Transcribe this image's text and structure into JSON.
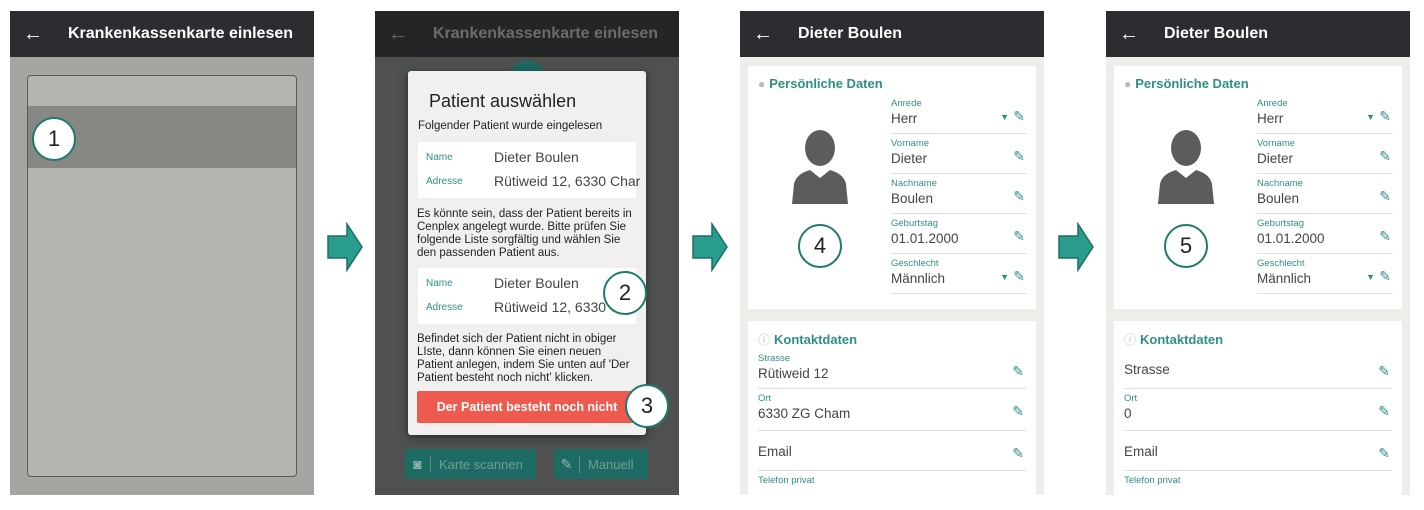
{
  "screen1": {
    "title": "Krankenkassenkarte einlesen",
    "callout": "1"
  },
  "screen2": {
    "title": "Krankenkassenkarte einlesen",
    "dialog_title": "Patient auswählen",
    "intro": "Folgender Patient wurde eingelesen",
    "card1": {
      "name_label": "Name",
      "name": "Dieter Boulen",
      "address_label": "Adresse",
      "address": "Rütiweid 12, 6330 Char"
    },
    "para1": "Es könnte sein, dass der Patient bereits in Cenplex angelegt wurde. Bitte prüfen Sie folgende Liste sorgfältig und wählen Sie den passenden Patient aus.",
    "card2": {
      "name_label": "Name",
      "name": "Dieter Boulen",
      "address_label": "Adresse",
      "address": "Rütiweid 12, 6330 Ch"
    },
    "para2": "Befindet sich der Patient nicht in obiger LIste, dann können Sie einen neuen Patient anlegen, indem Sie unten auf 'Der Patient besteht noch nicht' klicken.",
    "new_patient_button": "Der Patient besteht noch nicht",
    "scan_button": "Karte scannen",
    "manual_button": "Manuell",
    "callout_a": "2",
    "callout_b": "3"
  },
  "screen3": {
    "title": "Dieter Boulen",
    "section_personal": "Persönliche Daten",
    "fields": [
      {
        "label": "Anrede",
        "value": "Herr"
      },
      {
        "label": "Vorname",
        "value": "Dieter"
      },
      {
        "label": "Nachname",
        "value": "Boulen"
      },
      {
        "label": "Geburtstag",
        "value": "01.01.2000"
      },
      {
        "label": "Geschlecht",
        "value": "Männlich"
      }
    ],
    "section_contact": "Kontaktdaten",
    "contact": [
      {
        "label": "Strasse",
        "value": "Rütiweid 12"
      },
      {
        "label": "Ort",
        "value": "6330 ZG  Cham"
      },
      {
        "label": "",
        "value": "Email"
      },
      {
        "label": "Telefon privat",
        "value": ""
      }
    ],
    "callout": "4"
  },
  "screen4": {
    "title": "Dieter Boulen",
    "section_personal": "Persönliche Daten",
    "fields": [
      {
        "label": "Anrede",
        "value": "Herr"
      },
      {
        "label": "Vorname",
        "value": "Dieter"
      },
      {
        "label": "Nachname",
        "value": "Boulen"
      },
      {
        "label": "Geburtstag",
        "value": "01.01.2000"
      },
      {
        "label": "Geschlecht",
        "value": "Männlich"
      }
    ],
    "section_contact": "Kontaktdaten",
    "contact": [
      {
        "label": "",
        "value": "Strasse"
      },
      {
        "label": "Ort",
        "value": "0"
      },
      {
        "label": "",
        "value": "Email"
      },
      {
        "label": "Telefon privat",
        "value": ""
      }
    ],
    "callout": "5"
  },
  "icons": {
    "back": "arrow-left-icon",
    "edit": "pencil-icon",
    "dropdown": "caret-down-icon",
    "camera": "camera-icon",
    "person": "person-icon",
    "info": "info-icon",
    "step": "right-arrow-icon"
  },
  "colors": {
    "appbar": "#2b2d30",
    "accent": "#2f8f83",
    "danger": "#ef5a4e",
    "step_arrow": "#2a9d8f"
  }
}
